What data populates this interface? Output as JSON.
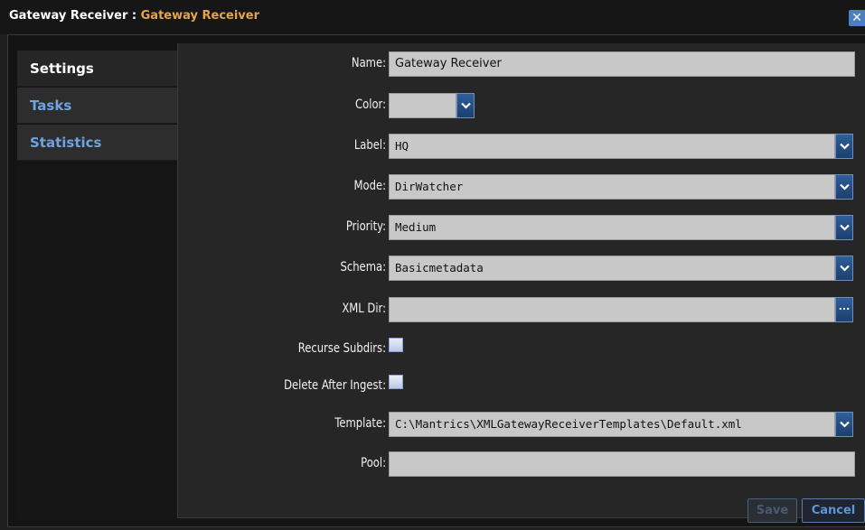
{
  "window": {
    "title_owner": "Gateway Receiver",
    "title_sep": " : ",
    "title_sub": "Gateway Receiver",
    "close_label": "✕"
  },
  "sidebar": {
    "items": [
      {
        "label": "Settings",
        "active": true
      },
      {
        "label": "Tasks",
        "active": false
      },
      {
        "label": "Statistics",
        "active": false
      }
    ]
  },
  "form": {
    "name": {
      "label": "Name:",
      "value": "Gateway Receiver"
    },
    "color": {
      "label": "Color:",
      "value": ""
    },
    "label": {
      "label": "Label:",
      "value": "HQ"
    },
    "mode": {
      "label": "Mode:",
      "value": "DirWatcher"
    },
    "priority": {
      "label": "Priority:",
      "value": "Medium"
    },
    "schema": {
      "label": "Schema:",
      "value": "Basicmetadata"
    },
    "xml_dir": {
      "label": "XML Dir:",
      "value": "",
      "browse_label": "..."
    },
    "recurse_subdirs": {
      "label": "Recurse Subdirs:",
      "checked": false
    },
    "delete_after_ingest": {
      "label": "Delete After Ingest:",
      "checked": false
    },
    "template": {
      "label": "Template:",
      "value": "C:\\Mantrics\\XMLGatewayReceiverTemplates\\Default.xml"
    },
    "pool": {
      "label": "Pool:",
      "value": ""
    }
  },
  "footer": {
    "save_label": "Save",
    "cancel_label": "Cancel"
  },
  "colors": {
    "accent": "#e7a54a",
    "link": "#6ea3e0",
    "button": "#2f5f9a"
  }
}
